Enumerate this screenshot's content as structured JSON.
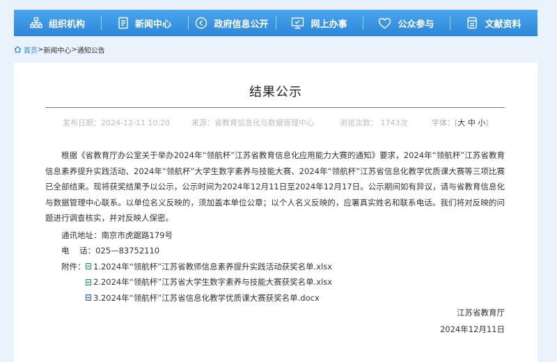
{
  "nav": {
    "items": [
      {
        "label": "组织机构",
        "icon": "org-chart-icon"
      },
      {
        "label": "新闻中心",
        "icon": "news-icon"
      },
      {
        "label": "政府信息公开",
        "icon": "info-open-icon"
      },
      {
        "label": "网上办事",
        "icon": "monitor-icon"
      },
      {
        "label": "公众参与",
        "icon": "heart-icon"
      },
      {
        "label": "文献资料",
        "icon": "documents-icon"
      }
    ]
  },
  "breadcrumb": {
    "home": "首页",
    "sep1": ">",
    "level1": "新闻中心",
    "sep2": ">",
    "level2": "通知公告"
  },
  "article": {
    "title": "结果公示",
    "meta": {
      "date": "发布日期：2024-12-11 10:20",
      "source": "来源：省教育信息化与数据管理中心",
      "views": "浏览次数：  1743次",
      "font_label": "字体：[",
      "font_large": "大",
      "font_medium": "中",
      "font_small": "小",
      "font_end": "]"
    },
    "paragraph": "根据《省教育厅办公室关于举办2024年“领航杯”江苏省教育信息化应用能力大赛的通知》要求，2024年“领航杯”江苏省教育信息素养提升实践活动、2024年“领航杯”大学生数字素养与技能大赛、2024年“领航杯”江苏省信息化教学优质课大赛等三项比赛已全部结束。现将获奖结果予以公示，公示时间为2024年12月11日至2024年12月17日。公示期间如有异议，请与省教育信息化与数据管理中心联系。以单位名义反映的，须加盖本单位公章；以个人名义反映的，应署真实姓名和联系电话。我们将对反映的问题进行调查核实，并对反映人保密。",
    "address": "通讯地址：南京市虎踞路179号",
    "phone": "电    话：025—83752110",
    "attachments_label": "附件：",
    "attachments": [
      {
        "name": "1.2024年“领航杯”江苏省教师信息素养提升实践活动获奖名单.xlsx",
        "type": "xlsx"
      },
      {
        "name": "2.2024年“领航杯”江苏省大学生数字素养与技能大赛获奖名单.xlsx",
        "type": "xlsx"
      },
      {
        "name": "3.2024年“领航杯”江苏省信息化教学优质课大赛获奖名单.docx",
        "type": "docx"
      }
    ],
    "signature": "江苏省教育厅",
    "sign_date": "2024年12月11日"
  },
  "colors": {
    "nav_top": "#4aa6ee",
    "nav_bottom": "#2d86d8",
    "page_bg": "#eaf3fb",
    "link": "#2d7fd2"
  }
}
